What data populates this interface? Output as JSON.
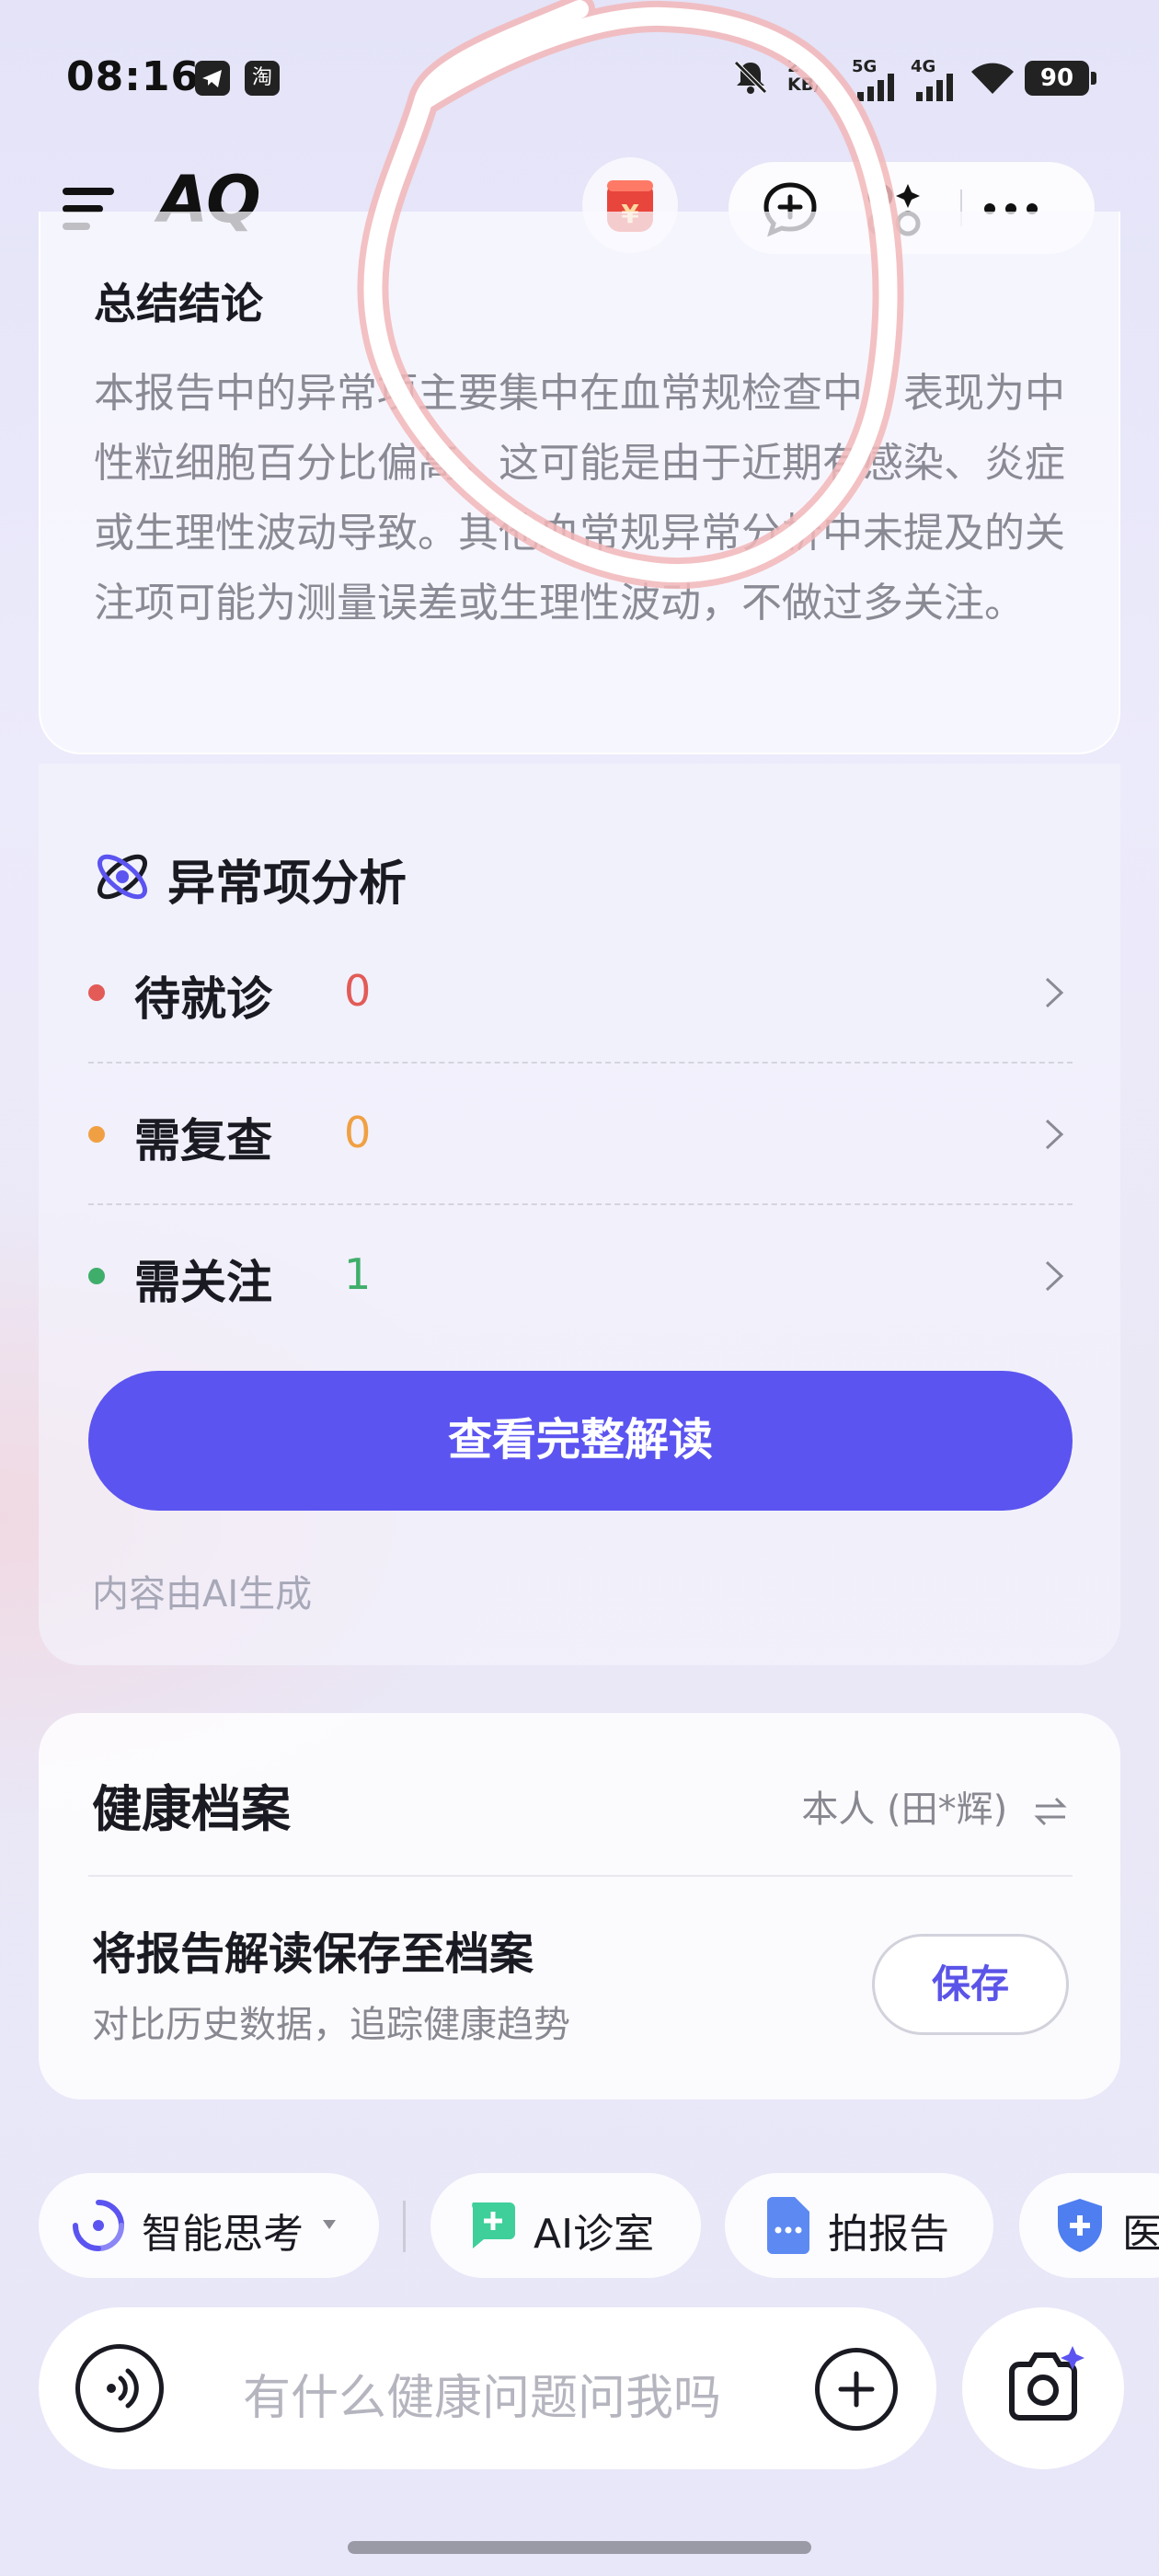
{
  "status_bar": {
    "time": "08:16",
    "app_icons": [
      "telegram-icon",
      "taobao-icon"
    ],
    "taobao_glyph": "淘",
    "net_speed_value": "2",
    "net_speed_unit": "KB/s",
    "sig1": "5G",
    "sig2": "4G",
    "battery": "90"
  },
  "nav": {
    "logo": "AQ",
    "icons": [
      "menu-icon",
      "coin-jar-icon",
      "new-chat-icon",
      "apps-icon",
      "more-icon"
    ]
  },
  "summary": {
    "title": "总结结论",
    "text": "本报告中的异常项主要集中在血常规检查中，表现为中性粒细胞百分比偏高，这可能是由于近期有感染、炎症或生理性波动导致。其他血常规异常分析中未提及的关注项可能为测量误差或生理性波动，不做过多关注。"
  },
  "analysis": {
    "title": "异常项分析",
    "rows": [
      {
        "label": "待就诊",
        "count": "0",
        "color": "#e25b57"
      },
      {
        "label": "需复查",
        "count": "0",
        "color": "#f0a043"
      },
      {
        "label": "需关注",
        "count": "1",
        "color": "#3fae6a"
      }
    ],
    "button": "查看完整解读",
    "ai_note": "内容由AI生成"
  },
  "health": {
    "title": "健康档案",
    "profile": "本人 (田*辉)",
    "save_title": "将报告解读保存至档案",
    "save_sub": "对比历史数据，追踪健康趋势",
    "save_button": "保存"
  },
  "chips": [
    {
      "label": "智能思考",
      "icon": "thinking-icon"
    },
    {
      "label": "AI诊室",
      "icon": "ai-clinic-icon"
    },
    {
      "label": "拍报告",
      "icon": "report-photo-icon"
    },
    {
      "label": "医",
      "icon": "medical-shield-icon"
    }
  ],
  "input": {
    "placeholder": "有什么健康问题问我吗"
  },
  "colors": {
    "accent": "#5b54f0",
    "annotation": "#e0484d"
  }
}
